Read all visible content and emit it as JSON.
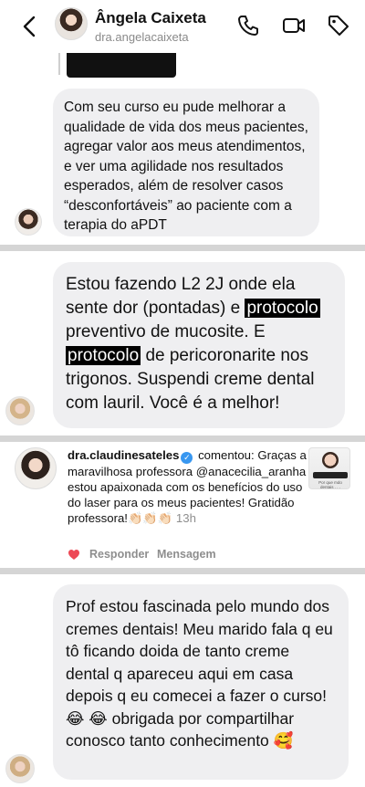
{
  "header": {
    "name": "Ângela Caixeta",
    "username": "dra.angelacaixeta"
  },
  "messages": {
    "m1": "Com seu curso eu pude melhorar a qualidade de vida dos meus pacientes, agregar valor aos meus atendimentos, e ver uma agilidade nos resultados esperados, além de resolver casos “desconfortáveis” ao paciente com a terapia do aPDT",
    "m2_part1": "Estou fazendo L2 2J onde ela sente dor (pontadas) e ",
    "m2_hl1": "protocolo",
    "m2_part2": " preventivo de mucosite. E ",
    "m2_hl2": "protocolo",
    "m2_part3": " de pericoronarite nos trigonos. Suspendi creme dental com lauril. Você é a melhor!",
    "m4": "Prof estou fascinada pelo mundo dos cremes dentais! Meu marido fala q eu tô ficando doida de tanto creme dental q apareceu aqui em casa depois q eu comecei a fazer o curso!😂 😂  obrigada por compartilhar conosco tanto conhecimento 🥰"
  },
  "comment": {
    "username": "dra.claudinesateles",
    "action": " comentou:",
    "text": " Graças a maravilhosa professora @anacecilia_aranha estou apaixonada com os benefícios do uso do laser para os meus pacientes! Gratidão professora!👏🏻👏🏻👏🏻 ",
    "time": "13h",
    "reply_label": "Responder",
    "message_label": "Mensagem",
    "thumb_text": "Por que mdo dentais . . ."
  },
  "colors": {
    "bubble": "#efeff1",
    "divider": "#d5d5d5",
    "heart": "#ed4956",
    "verified": "#3897f0"
  },
  "icons": [
    "back-chevron-icon",
    "phone-icon",
    "video-call-icon",
    "tag-icon",
    "heart-icon",
    "verified-badge-icon"
  ]
}
